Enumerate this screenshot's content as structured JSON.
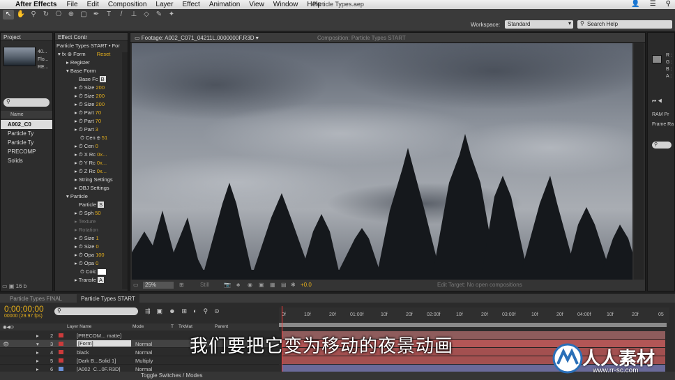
{
  "menubar": {
    "app": "After Effects",
    "items": [
      "File",
      "Edit",
      "Composition",
      "Layer",
      "Effect",
      "Animation",
      "View",
      "Window",
      "Help"
    ],
    "document_title": "Particle Types.aep"
  },
  "toolbar": {
    "workspace_label": "Workspace:",
    "workspace_value": "Standard",
    "search_placeholder": "Search Help"
  },
  "project": {
    "tab": "Project",
    "info": [
      "40...",
      "Flo...",
      "RE..."
    ],
    "header_name": "Name",
    "items": [
      "A002_C0",
      "Particle Ty",
      "Particle Ty",
      "PRECOMP",
      "Solids"
    ],
    "bpc": "16 b"
  },
  "effect_controls": {
    "tab": "Effect Contr",
    "subtitle": "Particle Types START • For",
    "effect_name": "Form",
    "reset": "Reset",
    "rows": [
      {
        "label": "Register",
        "value": ""
      },
      {
        "label": "Base Form",
        "value": ""
      },
      {
        "label": "Base Fc",
        "value": "B"
      },
      {
        "label": "Size",
        "value": "200"
      },
      {
        "label": "Size",
        "value": "200"
      },
      {
        "label": "Size",
        "value": "200"
      },
      {
        "label": "Part",
        "value": "70"
      },
      {
        "label": "Part",
        "value": "70"
      },
      {
        "label": "Part",
        "value": "3"
      },
      {
        "label": "Cen",
        "value": "51"
      },
      {
        "label": "Cen",
        "value": "0"
      },
      {
        "label": "X Rc",
        "value": "0x..."
      },
      {
        "label": "Y Rc",
        "value": "0x..."
      },
      {
        "label": "Z Rc",
        "value": "0x..."
      },
      {
        "label": "String Settings",
        "value": ""
      },
      {
        "label": "OBJ Settings",
        "value": ""
      },
      {
        "label": "Particle",
        "value": ""
      },
      {
        "label": "Particle",
        "value": "S"
      },
      {
        "label": "Sph",
        "value": "50"
      },
      {
        "label": "Texture",
        "value": ""
      },
      {
        "label": "Rotation",
        "value": ""
      },
      {
        "label": "Size",
        "value": "1"
      },
      {
        "label": "Size",
        "value": "0"
      },
      {
        "label": "Opa",
        "value": "100"
      },
      {
        "label": "Opa",
        "value": "0"
      },
      {
        "label": "Colc",
        "value": ""
      },
      {
        "label": "Transfe",
        "value": "A"
      }
    ]
  },
  "viewer": {
    "tab_footage": "Footage: A002_C071_04211L.0000000F.R3D",
    "tab_comp": "Composition: Particle Types START",
    "zoom": "25%",
    "still": "Still",
    "exposure": "+0.0",
    "edit_target": "Edit Target: No open compositions"
  },
  "right_panel": {
    "rgb": [
      "R :",
      "G :",
      "B :",
      "A :"
    ],
    "ram": "RAM Pr",
    "frame": "Frame Ra"
  },
  "timeline": {
    "tab_final": "Particle Types FINAL",
    "tab_start": "Particle Types START",
    "timecode": "0;00;00;00",
    "fps": "00000 (29.97 fps)",
    "columns": {
      "layer_name": "Layer Name",
      "mode": "Mode",
      "t": "T",
      "trkmat": "TrkMat",
      "parent": "Parent"
    },
    "ruler": [
      "0f",
      "10f",
      "20f",
      "01:00f",
      "10f",
      "20f",
      "02:00f",
      "10f",
      "20f",
      "03:00f",
      "10f",
      "20f",
      "04:00f",
      "10f",
      "20f",
      "05"
    ],
    "layers": [
      {
        "num": "2",
        "name": "[PRECOM... matte]",
        "mode": "",
        "color": "#cc3b3b"
      },
      {
        "num": "3",
        "name": "[Form]",
        "mode": "Normal",
        "color": "#cc3b3b"
      },
      {
        "num": "4",
        "name": "black",
        "mode": "Normal",
        "color": "#cc3b3b"
      },
      {
        "num": "5",
        "name": "[Dark B...Solid 1]",
        "mode": "Multiply",
        "color": "#cc3b3b"
      },
      {
        "num": "6",
        "name": "[A002_C...0F.R3D]",
        "mode": "Normal",
        "color": "#6a8fd6"
      }
    ],
    "toggle": "Toggle Switches / Modes"
  },
  "overlay": {
    "subtitle": "我们要把它变为移动的夜景动画",
    "watermark": "人人素材",
    "watermark_url": "www.rr-sc.com"
  }
}
